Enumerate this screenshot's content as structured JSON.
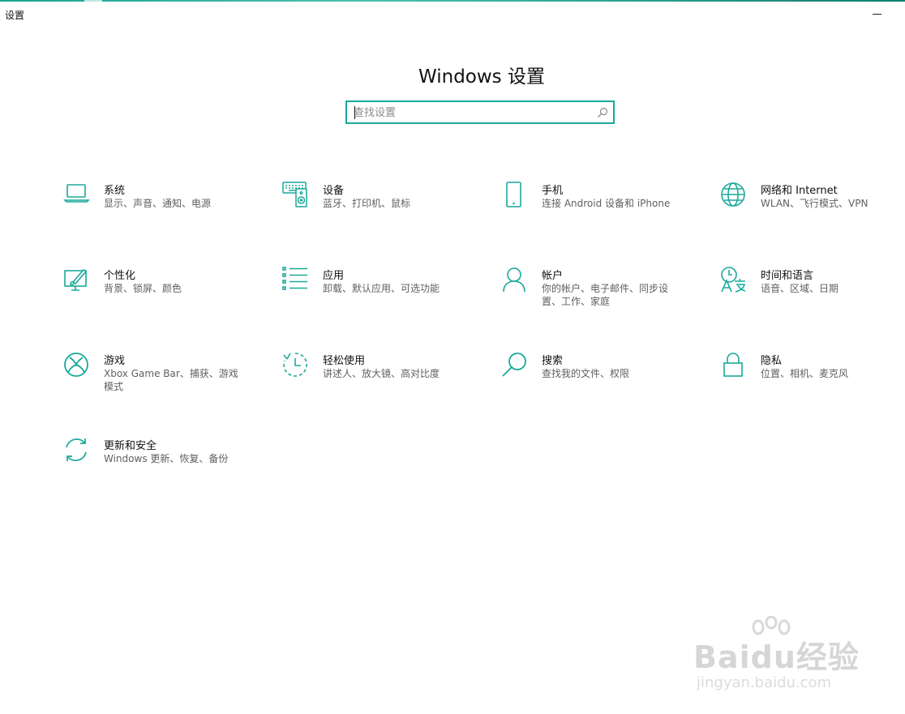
{
  "window": {
    "title": "设置"
  },
  "page": {
    "title": "Windows 设置"
  },
  "search": {
    "placeholder": "查找设置"
  },
  "accent_color": "#1aa99a",
  "tiles": [
    {
      "name": "系统",
      "desc": "显示、声音、通知、电源",
      "icon": "laptop-icon"
    },
    {
      "name": "设备",
      "desc": "蓝牙、打印机、鼠标",
      "icon": "devices-icon"
    },
    {
      "name": "手机",
      "desc": "连接 Android 设备和 iPhone",
      "icon": "phone-icon"
    },
    {
      "name": "网络和 Internet",
      "desc": "WLAN、飞行模式、VPN",
      "icon": "globe-icon"
    },
    {
      "name": "个性化",
      "desc": "背景、锁屏、颜色",
      "icon": "personalization-icon"
    },
    {
      "name": "应用",
      "desc": "卸载、默认应用、可选功能",
      "icon": "apps-list-icon"
    },
    {
      "name": "帐户",
      "desc": "你的帐户、电子邮件、同步设置、工作、家庭",
      "icon": "account-icon"
    },
    {
      "name": "时间和语言",
      "desc": "语音、区域、日期",
      "icon": "time-language-icon"
    },
    {
      "name": "游戏",
      "desc": "Xbox Game Bar、捕获、游戏模式",
      "icon": "xbox-icon"
    },
    {
      "name": "轻松使用",
      "desc": "讲述人、放大镜、高对比度",
      "icon": "ease-of-access-icon"
    },
    {
      "name": "搜索",
      "desc": "查找我的文件、权限",
      "icon": "search-icon"
    },
    {
      "name": "隐私",
      "desc": "位置、相机、麦克风",
      "icon": "lock-icon"
    },
    {
      "name": "更新和安全",
      "desc": "Windows 更新、恢复、备份",
      "icon": "update-icon"
    }
  ],
  "watermark": {
    "main": "Baidu经验",
    "sub": "jingyan.baidu.com"
  }
}
